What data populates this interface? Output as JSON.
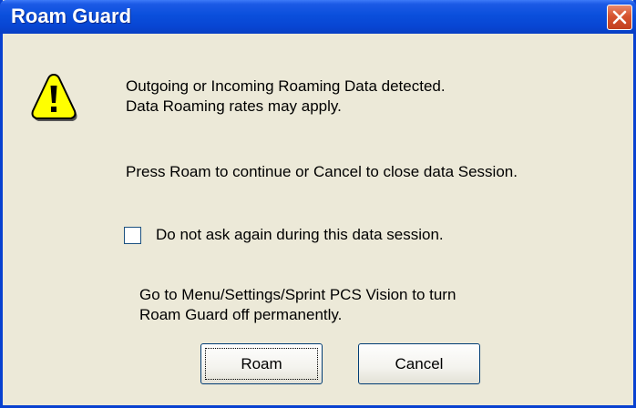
{
  "window": {
    "title": "Roam Guard"
  },
  "message": {
    "line1": "Outgoing or Incoming Roaming Data detected.",
    "line2": "Data Roaming rates may apply.",
    "line3": "Press Roam to continue or Cancel to close data Session.",
    "info_line1": "Go to Menu/Settings/Sprint PCS Vision to turn",
    "info_line2": "Roam Guard off permanently."
  },
  "checkbox": {
    "label": "Do not ask again during this data session.",
    "checked": false
  },
  "buttons": {
    "roam": "Roam",
    "cancel": "Cancel"
  },
  "icons": {
    "warning": "warning-icon",
    "close": "close-icon"
  },
  "colors": {
    "titlebar": "#0a4fdc",
    "close_button": "#d6532f",
    "dialog_background": "#ece9d8",
    "warning_yellow": "#ffff00"
  }
}
